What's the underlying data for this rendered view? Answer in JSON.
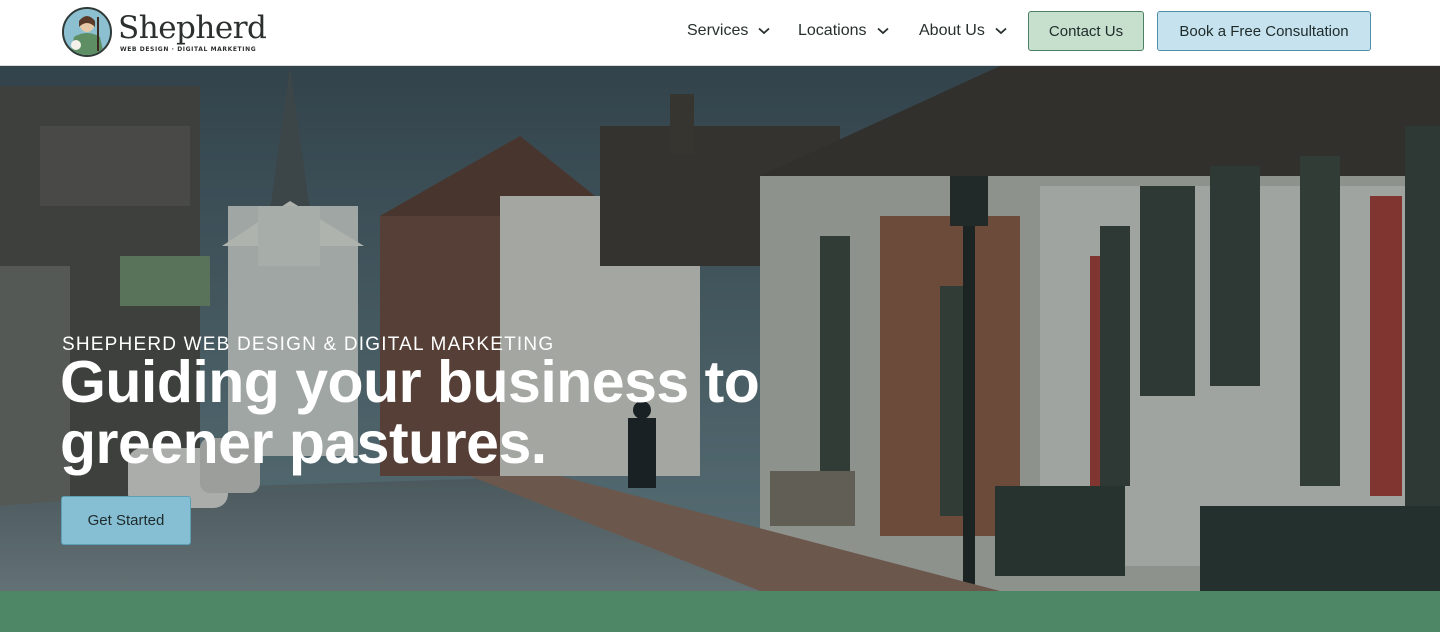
{
  "brand": {
    "name": "Shepherd",
    "tagline": "WEB DESIGN · DIGITAL MARKETING"
  },
  "nav": {
    "services": "Services",
    "locations": "Locations",
    "about": "About Us",
    "contact": "Contact Us",
    "consultation": "Book a Free Consultation"
  },
  "hero": {
    "eyebrow": "SHEPHERD WEB DESIGN & DIGITAL MARKETING",
    "headline_line1": "Guiding your business to",
    "headline_line2": "greener pastures.",
    "cta": "Get Started"
  },
  "colors": {
    "contact_bg": "#c6e0cd",
    "consult_bg": "#c5e2ee",
    "cta_bg": "#86bfd3",
    "band": "#4e8765"
  },
  "icons": {
    "dropdown": "chevron-down-icon",
    "logo": "shepherd-logo-icon"
  }
}
